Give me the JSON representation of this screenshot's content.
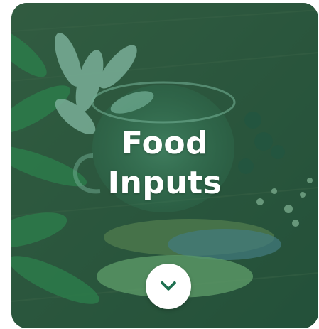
{
  "card": {
    "title_line1": "Food",
    "title_line2": "Inputs",
    "expand_icon": "chevron-down-icon",
    "accent": "#1e7858",
    "icon_color": "#1e7050"
  }
}
